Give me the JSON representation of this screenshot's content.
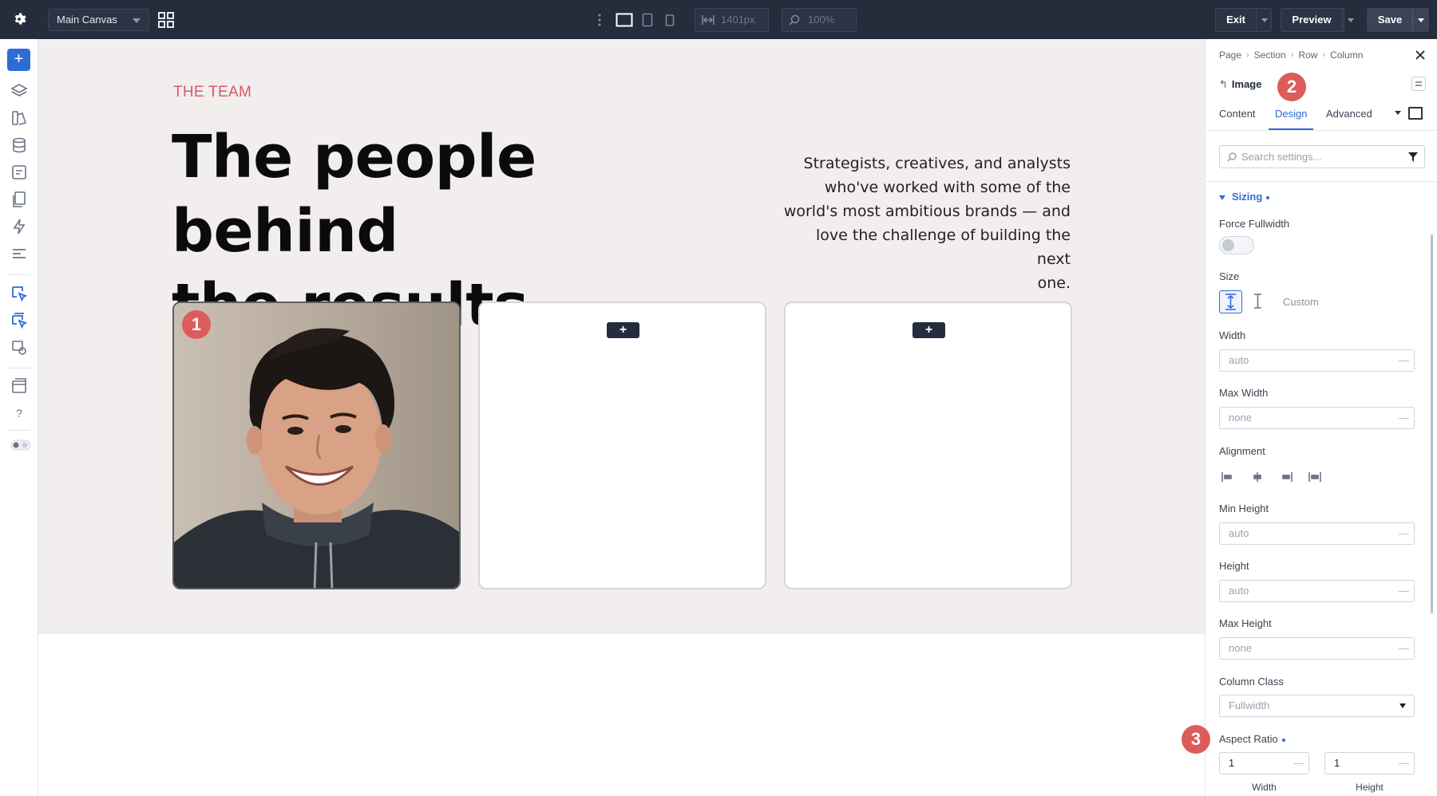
{
  "topbar": {
    "canvas_label": "Main Canvas",
    "width_value": "1401px",
    "zoom_value": "100%",
    "exit_label": "Exit",
    "preview_label": "Preview",
    "save_label": "Save"
  },
  "canvas": {
    "eyebrow": "THE TEAM",
    "headline_line1": "The people behind",
    "headline_line2": "the results.",
    "intro_lines": [
      "Strategists, creatives, and analysts",
      "who've worked with some of the",
      "world's most ambitious brands — and",
      "love the challenge of building the next",
      "one."
    ],
    "card_add_label": "+",
    "badge1": "1"
  },
  "panel": {
    "breadcrumb": [
      "Page",
      "Section",
      "Row",
      "Column"
    ],
    "module_title": "Image",
    "badge2": "2",
    "tabs": [
      "Content",
      "Design",
      "Advanced"
    ],
    "search_placeholder": "Search settings...",
    "group_title": "Sizing",
    "force_fullwidth_label": "Force Fullwidth",
    "size_label": "Size",
    "size_custom_label": "Custom",
    "width_label": "Width",
    "width_value": "auto",
    "max_width_label": "Max Width",
    "max_width_value": "none",
    "alignment_label": "Alignment",
    "min_height_label": "Min Height",
    "min_height_value": "auto",
    "height_label": "Height",
    "height_value": "auto",
    "max_height_label": "Max Height",
    "max_height_value": "none",
    "column_class_label": "Column Class",
    "column_class_value": "Fullwidth",
    "aspect_ratio_label": "Aspect Ratio",
    "badge3": "3",
    "ar_width_value": "1",
    "ar_height_value": "1",
    "ar_width_label": "Width",
    "ar_height_label": "Height",
    "dash": "—"
  },
  "colors": {
    "topbar": "#252d3c",
    "accent": "#2f6bd8",
    "eyebrow": "#d85a66",
    "badge": "#dc5c5c",
    "section_bg": "#f1eeed"
  }
}
